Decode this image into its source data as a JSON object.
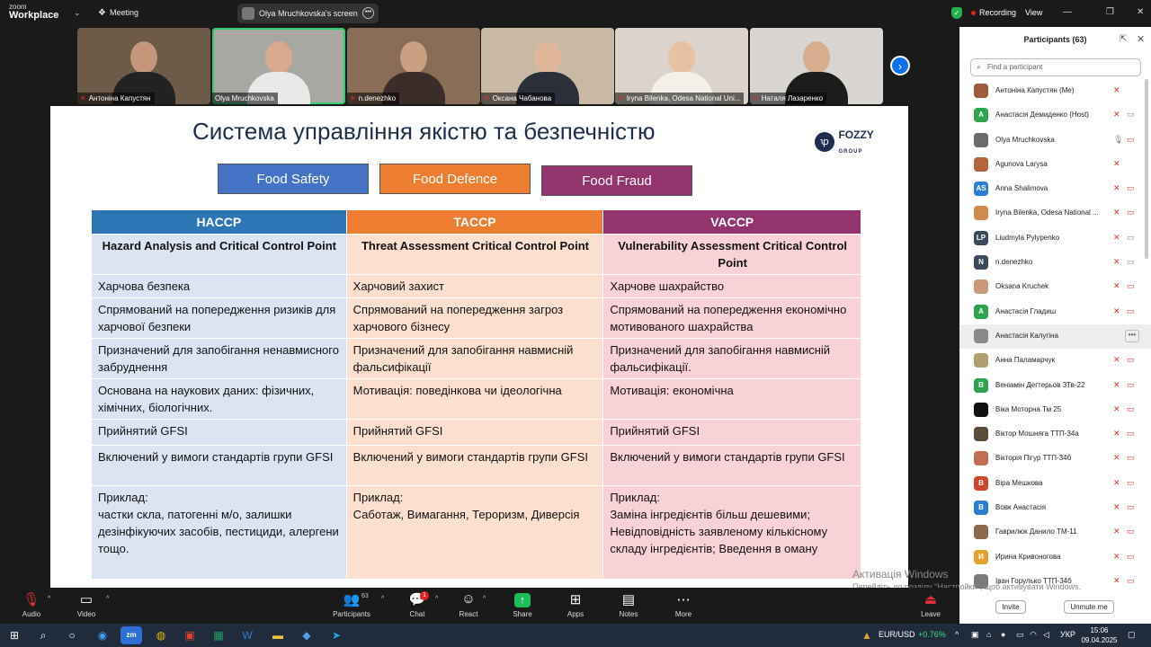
{
  "app": {
    "logo_line1": "zoom",
    "logo_line2": "Workplace",
    "meeting_label": "Meeting",
    "screen_share_label": "Olya Mruchkovska's screen",
    "recording_label": "Recording",
    "view_label": "View"
  },
  "video_tiles": [
    {
      "name": "Антоніна Капустян",
      "muted": true
    },
    {
      "name": "Olya Mruchkovska",
      "muted": false
    },
    {
      "name": "n.denezhko",
      "muted": true
    },
    {
      "name": "Оксана Чабанова",
      "muted": true
    },
    {
      "name": "Iryna Bilenka, Odesa National Uni...",
      "muted": true
    },
    {
      "name": "Наталя Лазаренко",
      "muted": true
    }
  ],
  "slide": {
    "title": "Система управління якістю та безпечністю",
    "brand_name": "FOZZY",
    "brand_sub": "GROUP",
    "categories": [
      {
        "label": "Food Safety",
        "color": "#4472c4"
      },
      {
        "label": "Food Defence",
        "color": "#ed7d31"
      },
      {
        "label": "Food Fraud",
        "color": "#93346e"
      }
    ],
    "columns": [
      {
        "header": "HACCP",
        "color": "#2e75b6"
      },
      {
        "header": "TACCP",
        "color": "#ed7d31"
      },
      {
        "header": "VACCP",
        "color": "#93346e"
      }
    ],
    "subheaders": [
      "Hazard Analysis and Critical Control Point",
      "Threat Assessment Critical Control Point",
      "Vulnerability Assessment Critical Control Point"
    ],
    "rows": [
      [
        "Харчова безпека",
        "Харчовий захист",
        "Харчове шахрайство"
      ],
      [
        "Спрямований на попередження ризиків для харчової безпеки",
        "Спрямований на попередження загроз харчового бізнесу",
        "Спрямований на попередження економічно мотивованого шахрайства"
      ],
      [
        "Призначений для запобігання ненавмисного забруднення",
        "Призначений для запобігання навмисній фальсифікації",
        "Призначений для запобігання навмисній фальсифікації."
      ],
      [
        "Основана на наукових даних: фізичних, хімічних, біологічних.",
        "Мотивація: поведінкова чи ідеологічна",
        "Мотивація: економічна"
      ],
      [
        "Прийнятий GFSI",
        "Прийнятий GFSI",
        "Прийнятий GFSI"
      ],
      [
        "Включений у вимоги стандартів групи GFSI",
        "Включений у вимоги стандартів групи GFSI",
        "Включений у вимоги стандартів групи GFSI"
      ]
    ],
    "example_rows": [
      [
        "Приклад:",
        "частки скла, патогенні м/о, залишки дезінфікуючих засобів, пестициди, алергени тощо."
      ],
      [
        "Приклад:",
        "Саботаж, Вимагання, Тероризм, Диверсія"
      ],
      [
        "Приклад:",
        "Заміна інгредієнтів більш дешевими; Невідповідність заявленому кількісному складу інгредієнтів; Введення в оману"
      ]
    ]
  },
  "watermark": {
    "line1": "Активація Windows",
    "line2": "Перейдіть до розділу \"Настройки\", щоб активувати Windows."
  },
  "participants_panel": {
    "title": "Participants (63)",
    "search_placeholder": "Find a participant",
    "invite_label": "Invite",
    "unmute_label": "Unmute me",
    "participants": [
      {
        "name": "Антоніна Капустян (Me)",
        "initials": "",
        "color": "#a05a3c"
      },
      {
        "name": "Анастасія Демиденко (Host)",
        "initials": "А",
        "color": "#2ea44f"
      },
      {
        "name": "Olya Mruchkovska",
        "initials": "",
        "color": "#6b6b6b"
      },
      {
        "name": "Agunova Larysa",
        "initials": "",
        "color": "#b5653c"
      },
      {
        "name": "Anna Shalimova",
        "initials": "AS",
        "color": "#2d7dd2"
      },
      {
        "name": "Iryna Bilenka, Odesa National ...",
        "initials": "",
        "color": "#d08a50"
      },
      {
        "name": "Liudmyla Pylypenko",
        "initials": "LP",
        "color": "#3b4a5a"
      },
      {
        "name": "n.denezhko",
        "initials": "N",
        "color": "#3b4a5a"
      },
      {
        "name": "Oksana Kruchek",
        "initials": "",
        "color": "#c99a7a"
      },
      {
        "name": "Анастасія Гладиш",
        "initials": "А",
        "color": "#2ea44f"
      },
      {
        "name": "Анастасія Калугіна",
        "initials": "",
        "color": "#8a8a8a"
      },
      {
        "name": "Анна Паламарчук",
        "initials": "",
        "color": "#b0a070"
      },
      {
        "name": "Веніамін Дегтерьов 3Тв-22",
        "initials": "В",
        "color": "#2ea44f"
      },
      {
        "name": "Віка Моторна Тм 25",
        "initials": "",
        "color": "#111111"
      },
      {
        "name": "Віктор Мошняга ТТП-34а",
        "initials": "",
        "color": "#5a4a3a"
      },
      {
        "name": "Вікторія Пігур ТТП-34б",
        "initials": "",
        "color": "#c07050"
      },
      {
        "name": "Віра Мешкова",
        "initials": "В",
        "color": "#d0452c"
      },
      {
        "name": "Вовк Анастасія",
        "initials": "В",
        "color": "#2d7dd2"
      },
      {
        "name": "Гаврилюк Данило ТМ-11",
        "initials": "",
        "color": "#8a6a4a"
      },
      {
        "name": "Ирина Кривоногова",
        "initials": "И",
        "color": "#e8a030"
      },
      {
        "name": "Іван Горулько ТТП-34б",
        "initials": "",
        "color": "#7a7a7a"
      }
    ]
  },
  "toolbar": {
    "audio_label": "Audio",
    "video_label": "Video",
    "participants_label": "Participants",
    "participants_count": "63",
    "chat_label": "Chat",
    "chat_badge": "1",
    "react_label": "React",
    "share_label": "Share",
    "apps_label": "Apps",
    "notes_label": "Notes",
    "more_label": "More",
    "leave_label": "Leave"
  },
  "taskbar": {
    "currency_label": "EUR/USD",
    "currency_change": "+0.76%",
    "language": "УКР",
    "time": "15:06",
    "date": "09.04.2025"
  }
}
